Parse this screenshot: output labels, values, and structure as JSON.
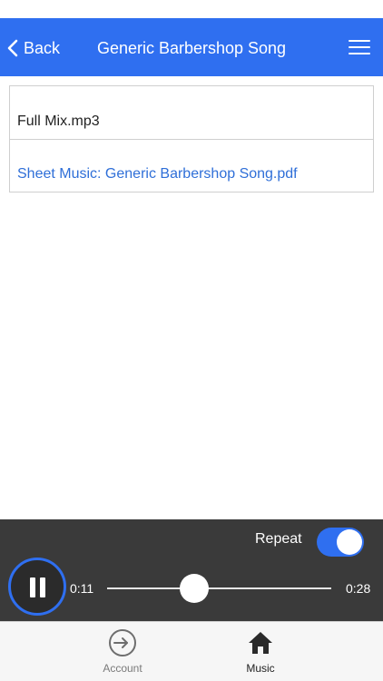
{
  "nav": {
    "back_label": "Back",
    "title": "Generic Barbershop Song",
    "menu_icon": "hamburger-menu-icon"
  },
  "files": [
    {
      "name": "Full Mix.mp3",
      "type": "audio"
    },
    {
      "name": "Sheet Music: Generic Barbershop Song.pdf",
      "type": "link"
    }
  ],
  "player": {
    "repeat_label": "Repeat",
    "repeat_on": true,
    "state": "playing",
    "current_time": "0:11",
    "total_time": "0:28",
    "progress": 0.39
  },
  "tabs": [
    {
      "label": "Account",
      "icon": "sign-in-icon",
      "active": false
    },
    {
      "label": "Music",
      "icon": "home-icon",
      "active": true
    }
  ],
  "colors": {
    "accent": "#2f6ff0",
    "link": "#2f6fd8",
    "player_bg": "#3a3a3a"
  }
}
